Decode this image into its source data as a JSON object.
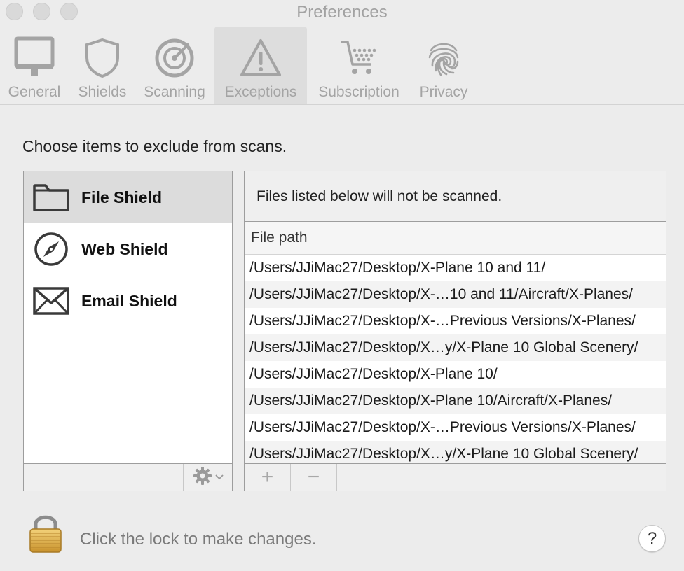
{
  "window": {
    "title": "Preferences"
  },
  "toolbar": {
    "tabs": [
      {
        "label": "General",
        "icon": "monitor-icon"
      },
      {
        "label": "Shields",
        "icon": "shield-icon"
      },
      {
        "label": "Scanning",
        "icon": "target-icon"
      },
      {
        "label": "Exceptions",
        "icon": "warning-icon",
        "active": true
      },
      {
        "label": "Subscription",
        "icon": "cart-icon"
      },
      {
        "label": "Privacy",
        "icon": "fingerprint-icon"
      }
    ]
  },
  "content": {
    "prompt": "Choose items to exclude from scans.",
    "shields": [
      {
        "label": "File Shield",
        "icon": "folder-icon",
        "selected": true
      },
      {
        "label": "Web Shield",
        "icon": "compass-icon"
      },
      {
        "label": "Email Shield",
        "icon": "envelope-icon"
      }
    ],
    "info": "Files listed below will not be scanned.",
    "column_header": "File path",
    "paths": [
      "/Users/JJiMac27/Desktop/X-Plane 10 and 11/",
      "/Users/JJiMac27/Desktop/X-…10 and 11/Aircraft/X-Planes/",
      "/Users/JJiMac27/Desktop/X-…Previous Versions/X-Planes/",
      "/Users/JJiMac27/Desktop/X…y/X-Plane 10 Global Scenery/",
      "/Users/JJiMac27/Desktop/X-Plane 10/",
      "/Users/JJiMac27/Desktop/X-Plane 10/Aircraft/X-Planes/",
      "/Users/JJiMac27/Desktop/X-…Previous Versions/X-Planes/",
      "/Users/JJiMac27/Desktop/X…y/X-Plane 10 Global Scenery/"
    ],
    "add_symbol": "+",
    "remove_symbol": "−"
  },
  "footer": {
    "lock_text": "Click the lock to make changes.",
    "help_label": "?"
  },
  "colors": {
    "window_bg": "#ececec",
    "icon_gray": "#a4a4a4",
    "selected_row": "#dcdcdc"
  }
}
